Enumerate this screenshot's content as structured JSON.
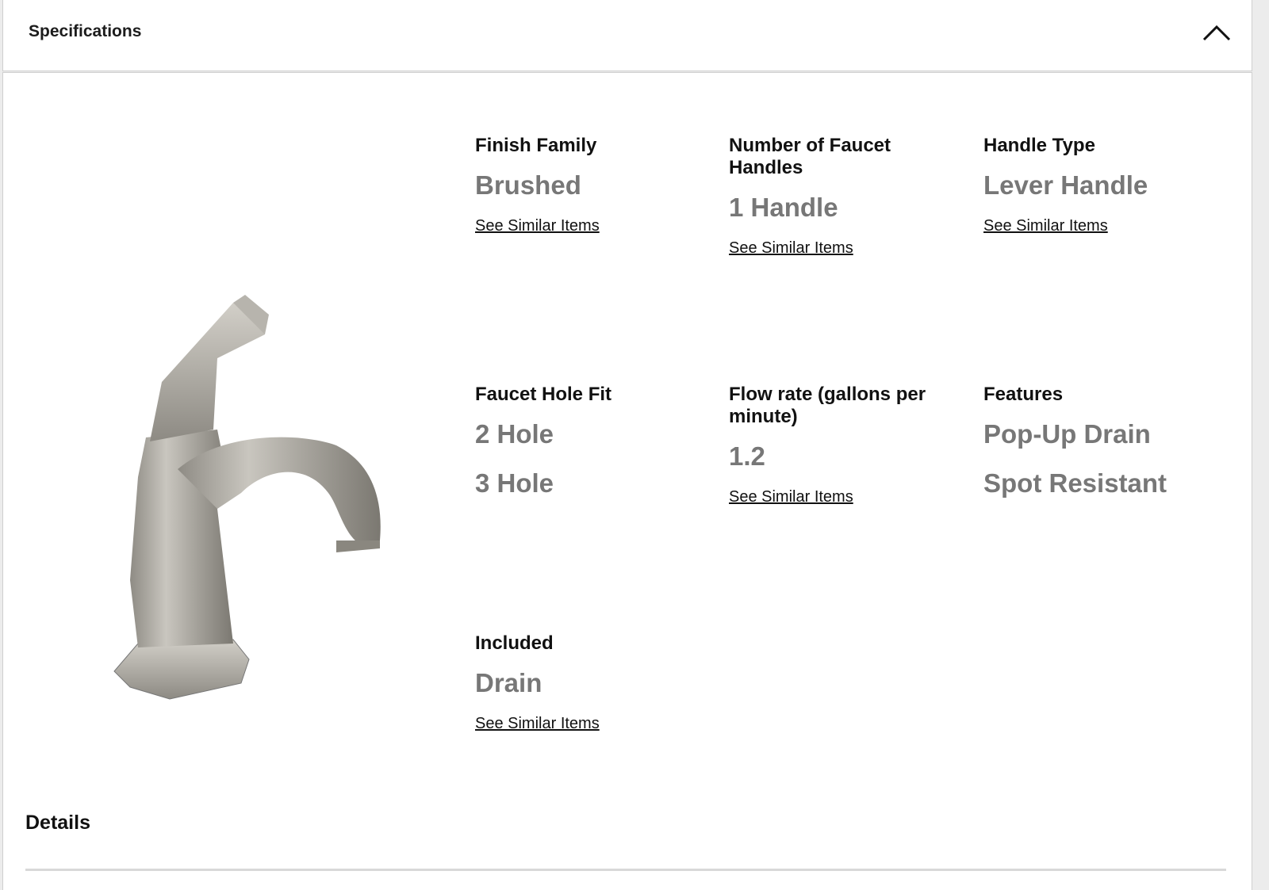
{
  "panel": {
    "title": "Specifications"
  },
  "specs": [
    {
      "label": "Finish Family",
      "values": [
        "Brushed"
      ],
      "link": "See Similar Items"
    },
    {
      "label": "Number of Faucet Handles",
      "values": [
        "1 Handle"
      ],
      "link": "See Similar Items"
    },
    {
      "label": "Handle Type",
      "values": [
        "Lever Handle"
      ],
      "link": "See Similar Items"
    },
    {
      "label": "Faucet Hole Fit",
      "values": [
        "2 Hole",
        "3 Hole"
      ]
    },
    {
      "label": "Flow rate (gallons per minute)",
      "values": [
        "1.2"
      ],
      "link": "See Similar Items"
    },
    {
      "label": "Features",
      "values": [
        "Pop-Up Drain",
        "Spot Resistant"
      ]
    },
    {
      "label": "Included",
      "values": [
        "Drain"
      ],
      "link": "See Similar Items"
    }
  ],
  "details": {
    "title": "Details"
  },
  "icons": {
    "collapse": "chevron-up-icon"
  },
  "colors": {
    "label": "#111111",
    "value": "#777777",
    "border": "#cfcfcf"
  }
}
